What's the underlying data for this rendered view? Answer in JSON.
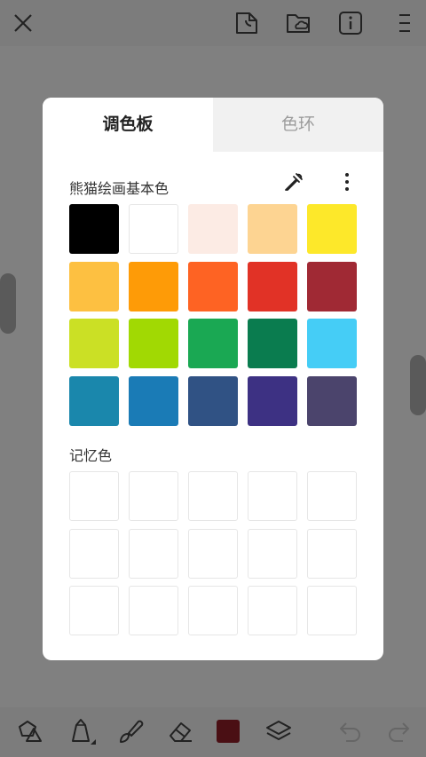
{
  "toolbar_top": {
    "icons": [
      "close-icon",
      "sticker-icon",
      "folder-cloud-icon",
      "info-icon",
      "menu-icon"
    ]
  },
  "toolbar_bottom": {
    "icons": [
      "shapes-icon",
      "pen-icon",
      "brush-icon",
      "eraser-icon",
      "current-color-icon",
      "layers-icon",
      "undo-icon",
      "redo-icon"
    ],
    "current_color": "#4a0f14"
  },
  "palette_dialog": {
    "tabs": [
      {
        "label": "调色板",
        "active": true
      },
      {
        "label": "色环",
        "active": false
      }
    ],
    "basic_section_label": "熊猫绘画基本色",
    "memory_section_label": "记忆色",
    "basic_colors": [
      "#000000",
      "#ffffff",
      "#fcebe4",
      "#fdd492",
      "#fde82a",
      "#fdc041",
      "#fe9b07",
      "#fe6323",
      "#e13226",
      "#a02934",
      "#cbe025",
      "#a1d903",
      "#1aa853",
      "#0a7c4f",
      "#45cdf6",
      "#1a87ac",
      "#1a7bb6",
      "#305284",
      "#3d3183",
      "#4b446c"
    ],
    "memory_colors": [
      "#ffffff",
      "#ffffff",
      "#ffffff",
      "#ffffff",
      "#ffffff",
      "#ffffff",
      "#ffffff",
      "#ffffff",
      "#ffffff",
      "#ffffff",
      "#ffffff",
      "#ffffff",
      "#ffffff",
      "#ffffff",
      "#ffffff"
    ]
  }
}
